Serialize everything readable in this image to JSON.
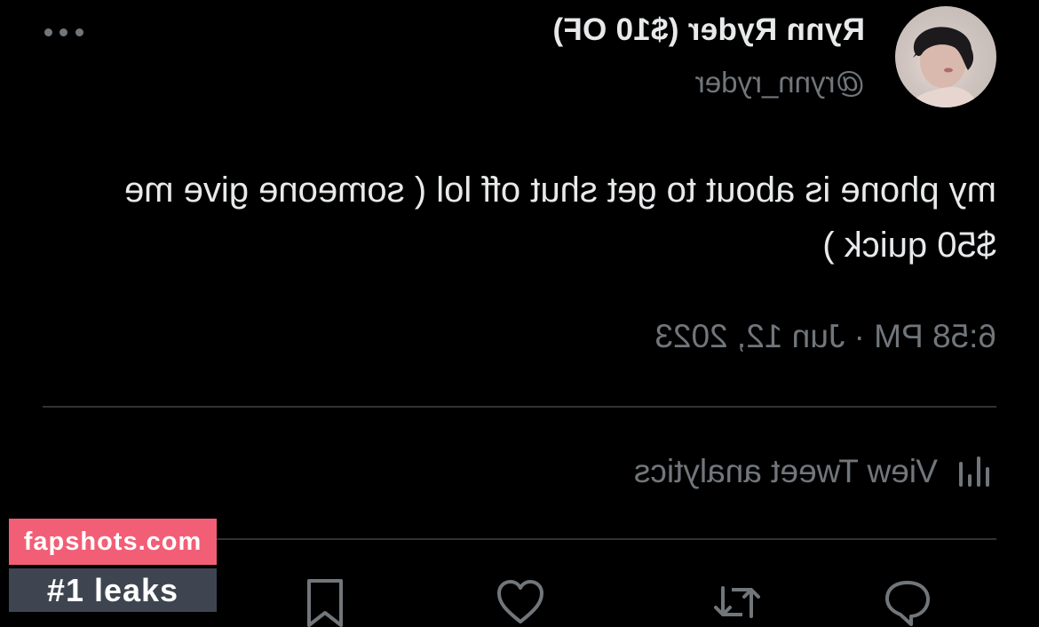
{
  "tweet": {
    "display_name": "Rynn Ryder ($10 OF)",
    "handle": "@rynn_ryder",
    "text": "my phone is about to get shut off lol ( someone give me $50 quick )",
    "timestamp": "6:58 PM · Jun 12, 2023",
    "analytics_label": "View Tweet analytics"
  },
  "icons": {
    "more": "more-horizontal-icon",
    "analytics": "analytics-bars-icon",
    "reply": "reply-icon",
    "retweet": "retweet-icon",
    "like": "heart-icon",
    "bookmark": "bookmark-icon"
  },
  "colors": {
    "background": "#000000",
    "primary_text": "#e7e9ea",
    "secondary_text": "#71767b",
    "divider": "#2f3336",
    "watermark_pink": "#f25e76",
    "watermark_dark": "#3e4550"
  },
  "watermark": {
    "site": "fapshots.com",
    "tagline": "#1 leaks"
  }
}
